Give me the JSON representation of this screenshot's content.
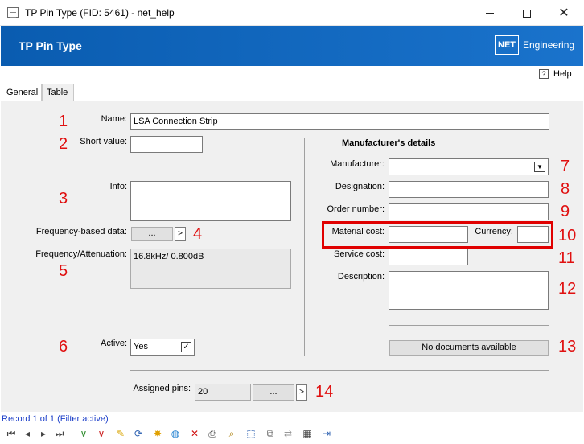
{
  "window": {
    "title": "TP Pin Type (FID: 5461) - net_help"
  },
  "header": {
    "heading": "TP Pin Type",
    "brand_box": "NET",
    "brand_word": "Engineering"
  },
  "help": {
    "label": "Help",
    "icon_text": "?"
  },
  "tabs": [
    {
      "label": "General",
      "active": true
    },
    {
      "label": "Table",
      "active": false
    }
  ],
  "form": {
    "name_label": "Name:",
    "name_value": "LSA Connection Strip",
    "short_value_label": "Short value:",
    "short_value": "",
    "info_label": "Info:",
    "info_value": "",
    "freq_data_label": "Frequency-based data:",
    "freq_data_button": "...",
    "freq_data_arrow": ">",
    "freq_atten_label": "Frequency/Attenuation:",
    "freq_atten_value": "16.8kHz/ 0.800dB",
    "active_label": "Active:",
    "active_value": "Yes",
    "active_checked": "✓",
    "assigned_pins_label": "Assigned pins:",
    "assigned_pins_value": "20",
    "assigned_pins_button": "...",
    "assigned_pins_arrow": ">"
  },
  "manufacturer": {
    "section_title": "Manufacturer's details",
    "manufacturer_label": "Manufacturer:",
    "manufacturer_value": "",
    "designation_label": "Designation:",
    "designation_value": "",
    "order_number_label": "Order number:",
    "order_number_value": "",
    "material_cost_label": "Material cost:",
    "material_cost_value": "",
    "currency_label": "Currency:",
    "currency_value": "",
    "service_cost_label": "Service cost:",
    "service_cost_value": "",
    "description_label": "Description:",
    "description_value": "",
    "no_documents": "No documents available"
  },
  "annotations": [
    "1",
    "2",
    "3",
    "4",
    "5",
    "6",
    "7",
    "8",
    "9",
    "10",
    "11",
    "12",
    "13",
    "14"
  ],
  "status": {
    "text": "Record 1 of 1 (Filter active)"
  },
  "colors": {
    "header_blue": "#0a5cb0",
    "annotation_red": "#e01010",
    "status_blue": "#1b3ec9"
  },
  "toolbar_icons": [
    "first-record-icon",
    "previous-record-icon",
    "next-record-icon",
    "last-record-icon",
    "filter-add-icon",
    "filter-remove-icon",
    "edit-icon",
    "refresh-icon",
    "new-icon",
    "globe-icon",
    "delete-icon",
    "print-icon",
    "search-icon",
    "select-icon",
    "copy-icon",
    "link-icon",
    "table-edit-icon",
    "exit-icon"
  ]
}
